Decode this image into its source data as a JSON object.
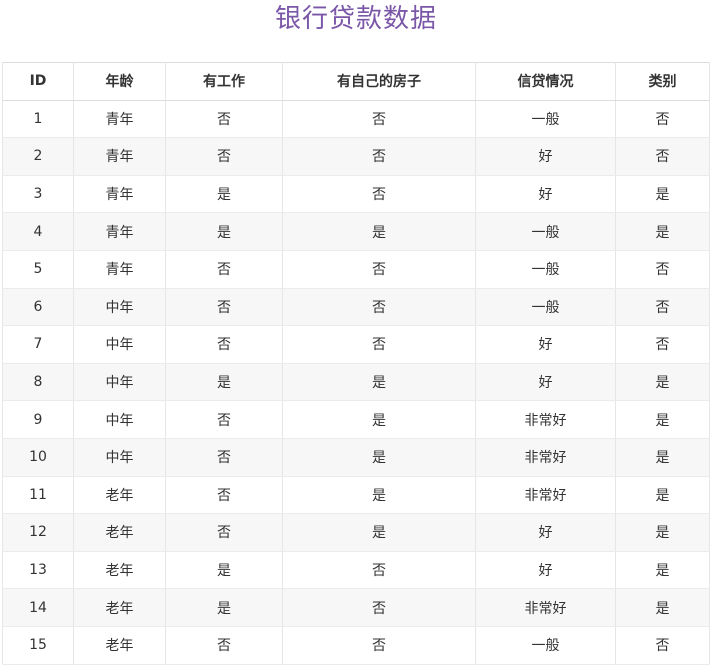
{
  "title": "银行贷款数据",
  "columns": [
    "ID",
    "年龄",
    "有工作",
    "有自己的房子",
    "信贷情况",
    "类别"
  ],
  "rows": [
    [
      "1",
      "青年",
      "否",
      "否",
      "一般",
      "否"
    ],
    [
      "2",
      "青年",
      "否",
      "否",
      "好",
      "否"
    ],
    [
      "3",
      "青年",
      "是",
      "否",
      "好",
      "是"
    ],
    [
      "4",
      "青年",
      "是",
      "是",
      "一般",
      "是"
    ],
    [
      "5",
      "青年",
      "否",
      "否",
      "一般",
      "否"
    ],
    [
      "6",
      "中年",
      "否",
      "否",
      "一般",
      "否"
    ],
    [
      "7",
      "中年",
      "否",
      "否",
      "好",
      "否"
    ],
    [
      "8",
      "中年",
      "是",
      "是",
      "好",
      "是"
    ],
    [
      "9",
      "中年",
      "否",
      "是",
      "非常好",
      "是"
    ],
    [
      "10",
      "中年",
      "否",
      "是",
      "非常好",
      "是"
    ],
    [
      "11",
      "老年",
      "否",
      "是",
      "非常好",
      "是"
    ],
    [
      "12",
      "老年",
      "否",
      "是",
      "好",
      "是"
    ],
    [
      "13",
      "老年",
      "是",
      "否",
      "好",
      "是"
    ],
    [
      "14",
      "老年",
      "是",
      "否",
      "非常好",
      "是"
    ],
    [
      "15",
      "老年",
      "否",
      "否",
      "一般",
      "否"
    ]
  ],
  "colors": {
    "title": "#7b57a8",
    "stripe": "#f7f7f7",
    "border": "#e6e6e6"
  }
}
